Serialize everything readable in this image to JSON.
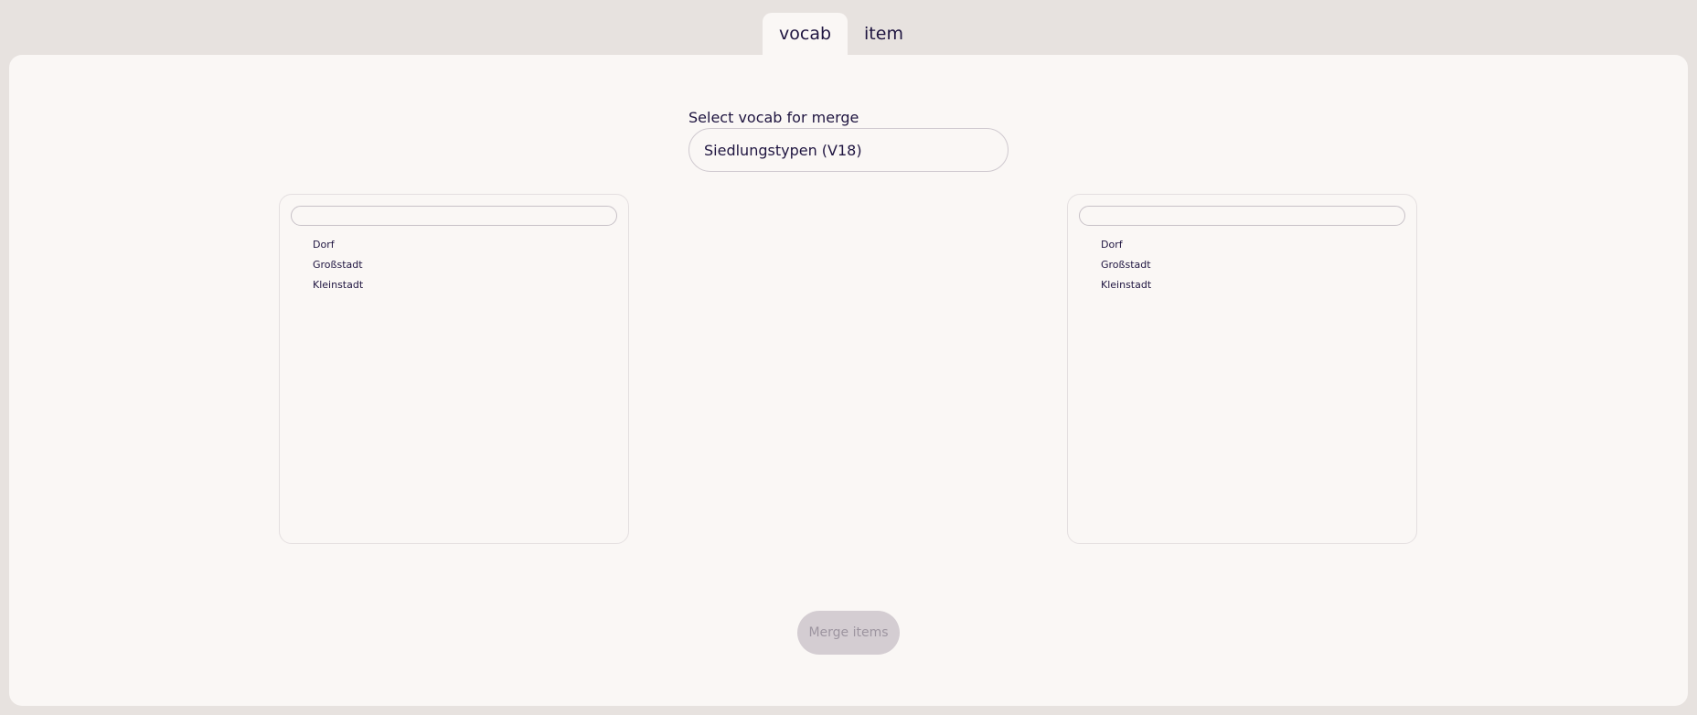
{
  "tabs": [
    {
      "label": "vocab",
      "active": true
    },
    {
      "label": "item",
      "active": false
    }
  ],
  "merge": {
    "select_label": "Select vocab for merge",
    "selected_vocab": "Siedlungstypen (V18)",
    "button_label": "Merge items"
  },
  "lists": {
    "left": {
      "filter_value": "",
      "items": [
        "Dorf",
        "Großstadt",
        "Kleinstadt"
      ]
    },
    "right": {
      "filter_value": "",
      "items": [
        "Dorf",
        "Großstadt",
        "Kleinstadt"
      ]
    }
  },
  "colors": {
    "background": "#e7e2df",
    "panel": "#faf7f5",
    "text": "#1f1540",
    "button_disabled": "#d4cdd2"
  }
}
